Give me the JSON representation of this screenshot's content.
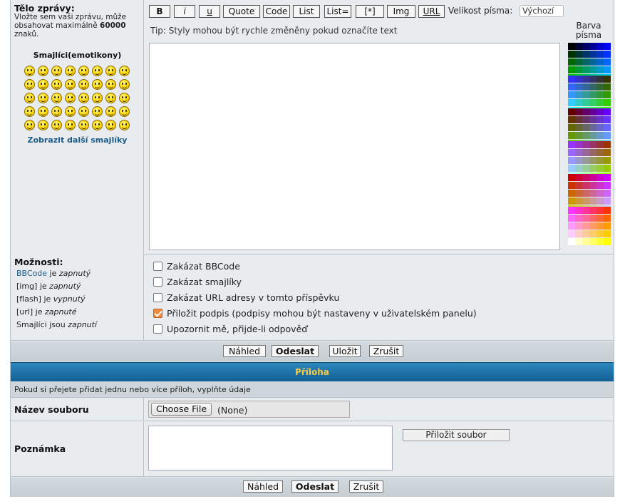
{
  "body_section": {
    "title": "Tělo zprávy:",
    "hint_prefix": "Vložte sem vaši zprávu, může obsahovat maximálně ",
    "hint_max": "60000",
    "hint_suffix": " znaků.",
    "smileys_title": "Smajlíci(emotikony)",
    "more_smileys": "Zobrazit další smajlíky",
    "smiley_count": 40
  },
  "toolbar": {
    "buttons": [
      "B",
      "i",
      "u",
      "Quote",
      "Code",
      "List",
      "List=",
      "[*]",
      "Img",
      "URL"
    ],
    "font_size_label": "Velikost písma:",
    "font_size_value": "Výchozí",
    "tip": "Tip: Styly mohou být rychle změněny pokud označíte text",
    "color_title_line1": "Barva",
    "color_title_line2": "písma"
  },
  "options": {
    "title": "Možnosti:",
    "status": [
      {
        "name": "BBCode",
        "mid": " je ",
        "state": "zapnutý",
        "link": true
      },
      {
        "name": "[img]",
        "mid": " je ",
        "state": "zapnutý",
        "link": false
      },
      {
        "name": "[flash]",
        "mid": " je ",
        "state": "vypnutý",
        "link": false
      },
      {
        "name": "[url]",
        "mid": " je ",
        "state": "zapnuté",
        "link": false
      },
      {
        "name": "Smajlíci",
        "mid": " jsou ",
        "state": "zapnutí",
        "link": false
      }
    ],
    "checkboxes": [
      {
        "label": "Zakázat BBCode",
        "checked": false
      },
      {
        "label": "Zakázat smajlíky",
        "checked": false
      },
      {
        "label": "Zakázat URL adresy v tomto příspěvku",
        "checked": false
      },
      {
        "label": "Přiložit podpis (podpisy mohou být nastaveny v uživatelském panelu)",
        "checked": true
      },
      {
        "label": "Upozornit mě, přijde-li odpověď",
        "checked": false
      }
    ]
  },
  "actions_top": {
    "preview": "Náhled",
    "submit": "Odeslat",
    "save": "Uložit",
    "cancel": "Zrušit"
  },
  "attachment": {
    "title": "Příloha",
    "hint": "Pokud si přejete přidat jednu nebo více příloh, vyplňte údaje",
    "file_label": "Název souboru",
    "choose_button": "Choose File",
    "file_value": "(None)",
    "note_label": "Poznámka",
    "attach_button": "Přiložit soubor"
  },
  "actions_bottom": {
    "preview": "Náhled",
    "submit": "Odeslat",
    "cancel": "Zrušit"
  }
}
